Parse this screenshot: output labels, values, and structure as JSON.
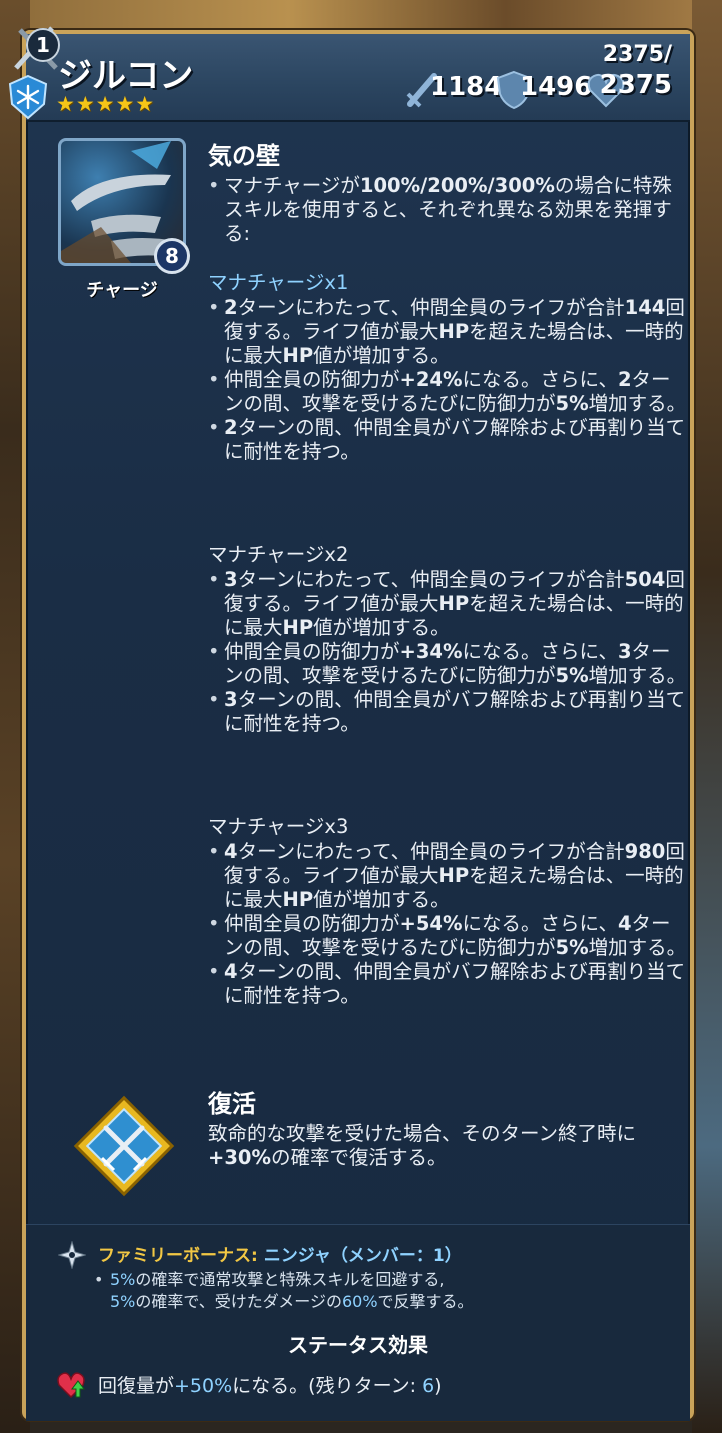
{
  "hero": {
    "level": "1",
    "name": "ジルコン",
    "stars": "★★★★★",
    "attack": "1184",
    "defense": "1496",
    "hp_current": "2375/",
    "hp_max": "2375",
    "element_icon": "snowflake-icon"
  },
  "special": {
    "title": "気の壁",
    "mana_cost": "8",
    "charge_label": "チャージ",
    "intro": [
      "マナチャージが",
      "100%/200%/300%",
      "の場合に特殊スキルを使用すると、それぞれ異なる効果を発揮する:"
    ],
    "tiers": [
      {
        "header": "マナチャージx1",
        "b1": [
          "2",
          "ターンにわたって、仲間全員のライフが合計",
          "144",
          "回復する。ライフ値が最大",
          "HP",
          "を超えた場合は、一時的に最大",
          "HP",
          "値が増加する。"
        ],
        "b2": [
          "仲間全員の防御力が",
          "+24%",
          "になる。さらに、",
          "2",
          "ターンの間、攻撃を受けるたびに防御力が",
          "5%",
          "増加する。"
        ],
        "b3": [
          "2",
          "ターンの間、仲間全員がバフ解除および再割り当てに耐性を持つ。"
        ]
      },
      {
        "header": "マナチャージx2",
        "b1": [
          "3",
          "ターンにわたって、仲間全員のライフが合計",
          "504",
          "回復する。ライフ値が最大",
          "HP",
          "を超えた場合は、一時的に最大",
          "HP",
          "値が増加する。"
        ],
        "b2": [
          "仲間全員の防御力が",
          "+34%",
          "になる。さらに、",
          "3",
          "ターンの間、攻撃を受けるたびに防御力が",
          "5%",
          "増加する。"
        ],
        "b3": [
          "3",
          "ターンの間、仲間全員がバフ解除および再割り当てに耐性を持つ。"
        ]
      },
      {
        "header": "マナチャージx3",
        "b1": [
          "4",
          "ターンにわたって、仲間全員のライフが合計",
          "980",
          "回復する。ライフ値が最大",
          "HP",
          "を超えた場合は、一時的に最大",
          "HP",
          "値が増加する。"
        ],
        "b2": [
          "仲間全員の防御力が",
          "+54%",
          "になる。さらに、",
          "4",
          "ターンの間、攻撃を受けるたびに防御力が",
          "5%",
          "増加する。"
        ],
        "b3": [
          "4",
          "ターンの間、仲間全員がバフ解除および再割り当てに耐性を持つ。"
        ]
      }
    ]
  },
  "passive": {
    "title": "復活",
    "desc": [
      "致命的な攻撃を受けた場合、そのターン終了時に",
      "+30%",
      "の確率で復活する。"
    ]
  },
  "family": {
    "label": "ファミリーボーナス:",
    "name": "ニンジャ（メンバー：1）",
    "line1": [
      "5%",
      "の確率で通常攻撃と特殊スキルを回避する,"
    ],
    "line2": [
      "5%",
      "の確率で、受けたダメージの",
      "60%",
      "で反撃する。"
    ]
  },
  "status": {
    "header": "ステータス効果",
    "pre": "回復量が",
    "value": "+50%",
    "mid": "になる。(残りターン: ",
    "turns": "6",
    "post": ")"
  }
}
